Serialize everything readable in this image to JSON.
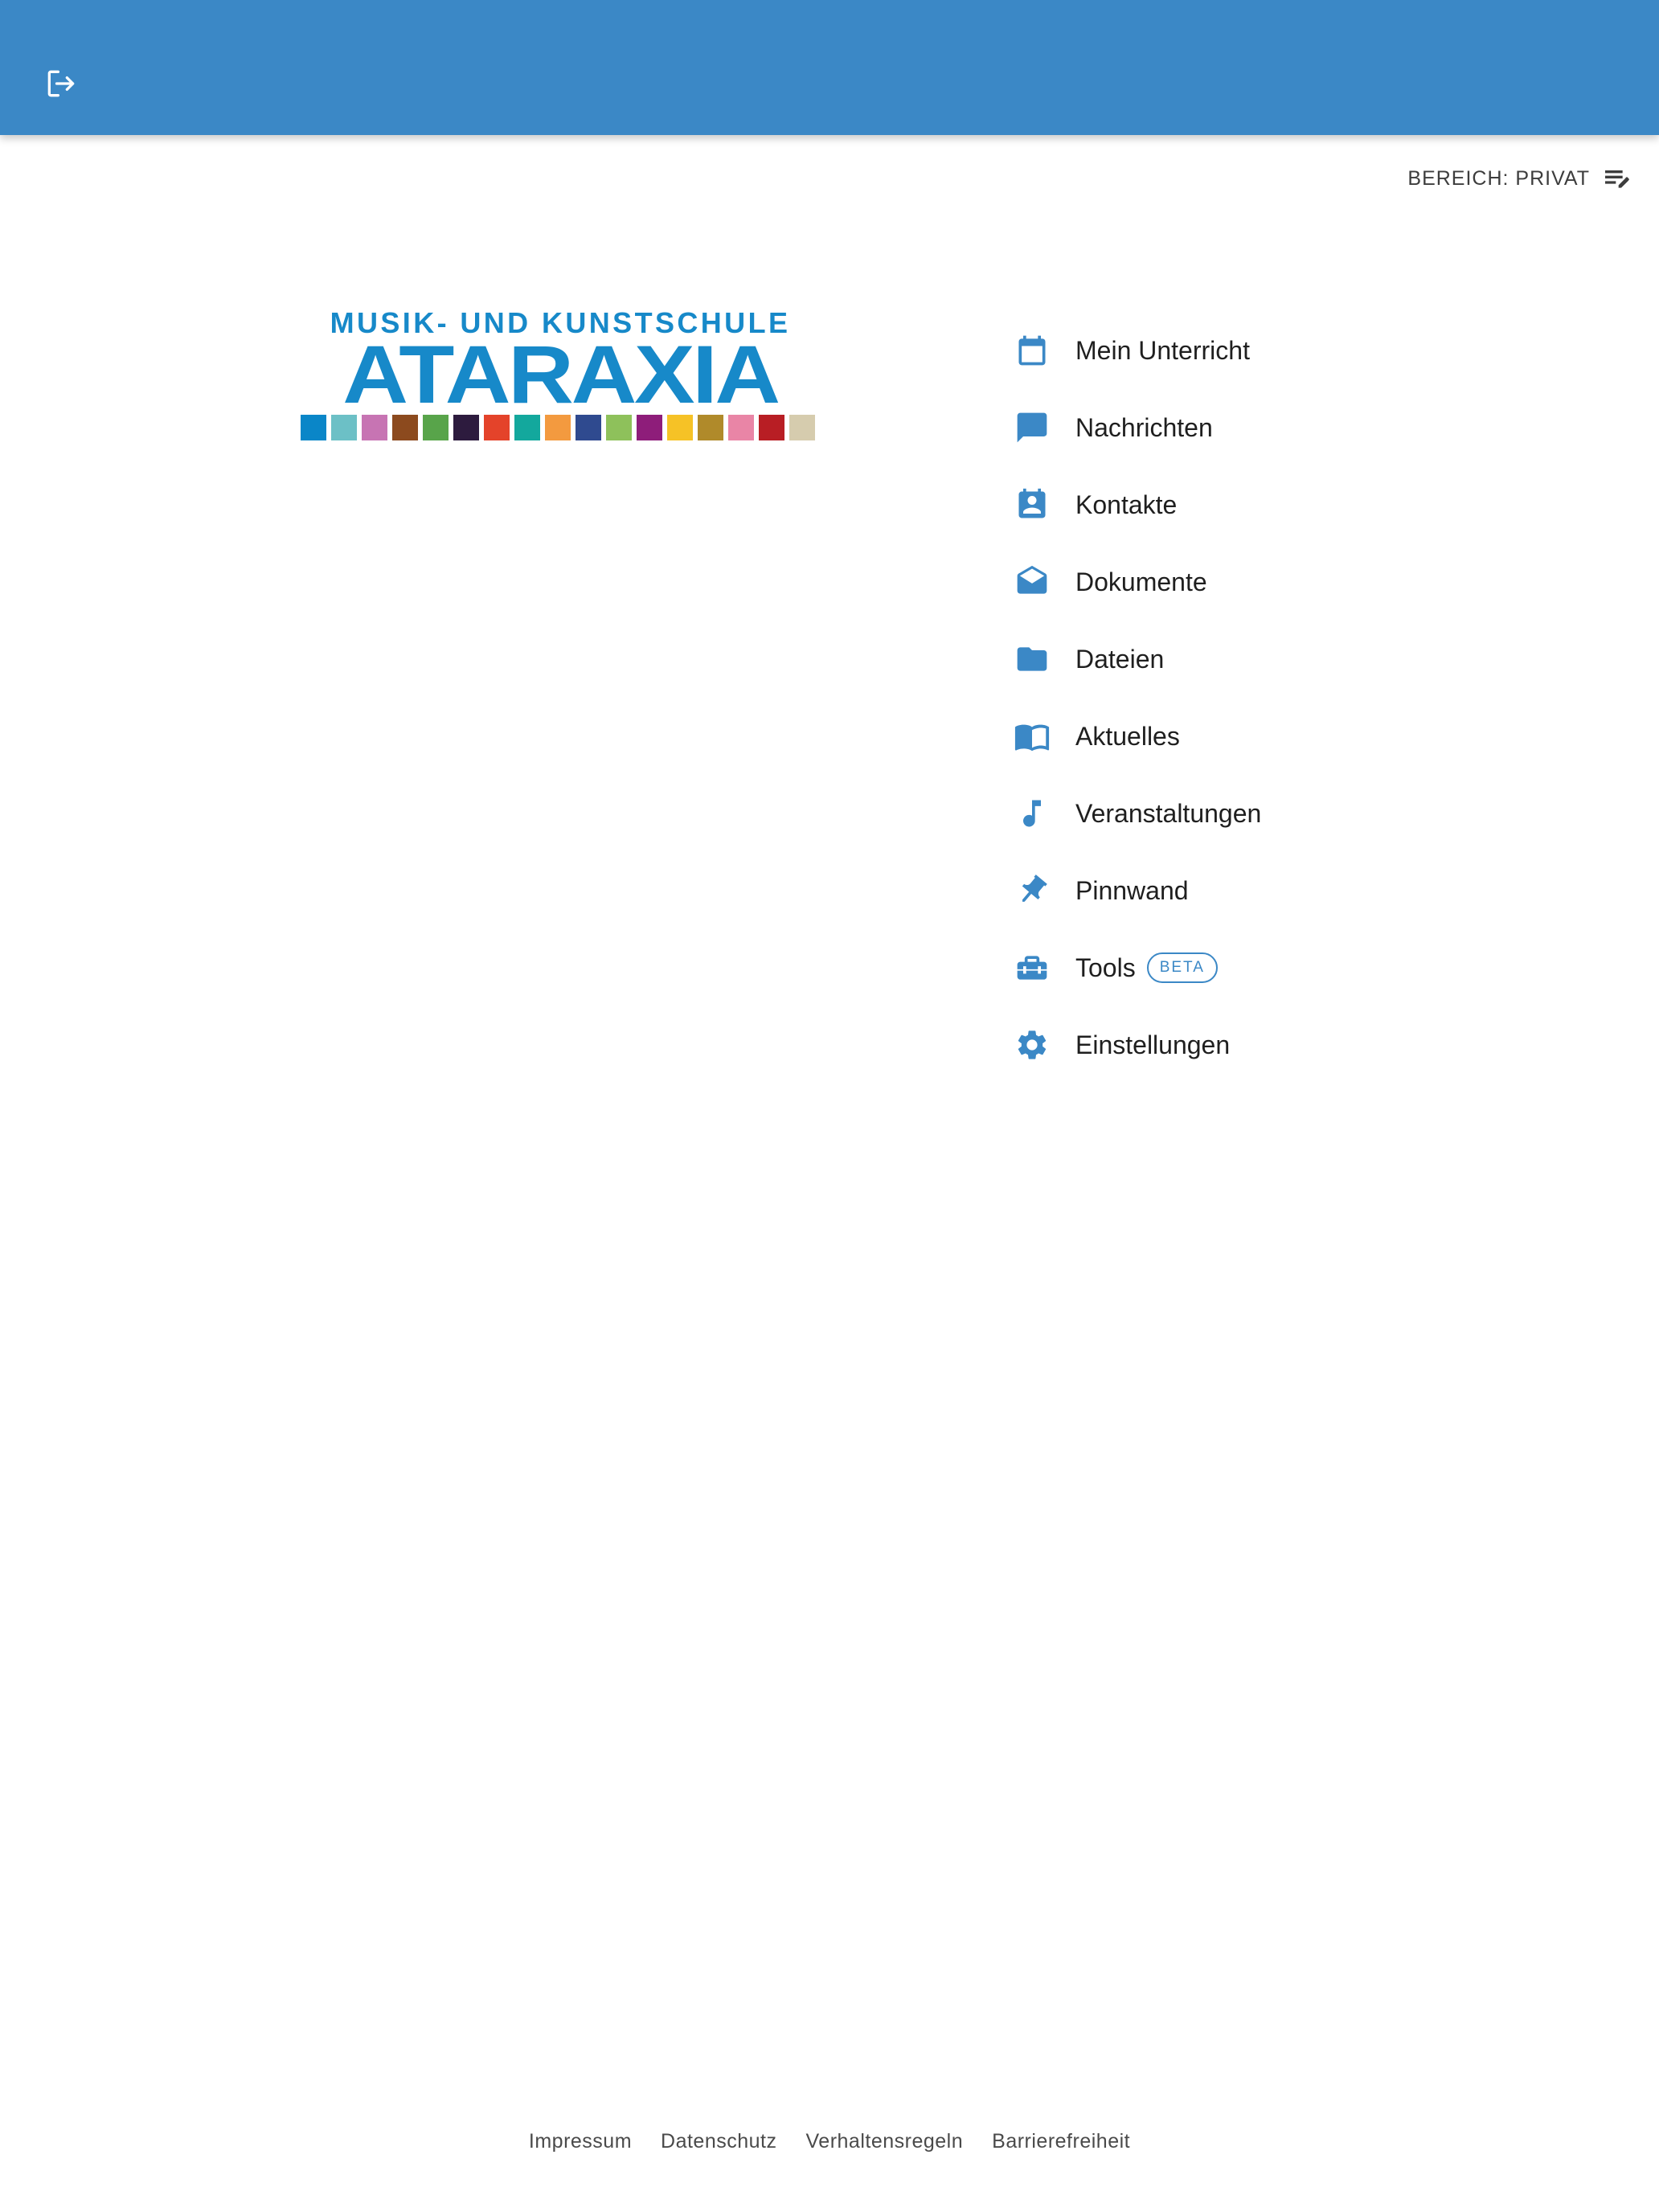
{
  "header": {
    "logout_icon": "logout-icon",
    "background_color": "#3b88c6"
  },
  "scope": {
    "label": "BEREICH: PRIVAT",
    "icon": "edit-list-icon"
  },
  "logo": {
    "line1": "MUSIK- UND KUNSTSCHULE",
    "line2": "ATARAXIA",
    "square_colors": [
      "#0a86c8",
      "#6cc0c6",
      "#c774b3",
      "#8c4a1e",
      "#58a44a",
      "#2d1b3e",
      "#e4432a",
      "#13a89d",
      "#f39a3f",
      "#2f4a8f",
      "#8ec15b",
      "#8e1d7a",
      "#f6c226",
      "#b08a2a",
      "#e985a6",
      "#b81e24",
      "#d6ccae"
    ]
  },
  "nav": {
    "items": [
      {
        "label": "Mein Unterricht",
        "icon": "calendar-icon"
      },
      {
        "label": "Nachrichten",
        "icon": "chat-icon"
      },
      {
        "label": "Kontakte",
        "icon": "contact-icon"
      },
      {
        "label": "Dokumente",
        "icon": "envelope-open-icon"
      },
      {
        "label": "Dateien",
        "icon": "folder-icon"
      },
      {
        "label": "Aktuelles",
        "icon": "book-icon"
      },
      {
        "label": "Veranstaltungen",
        "icon": "music-note-icon"
      },
      {
        "label": "Pinnwand",
        "icon": "pin-icon"
      },
      {
        "label": "Tools",
        "icon": "toolbox-icon",
        "badge": "BETA"
      },
      {
        "label": "Einstellungen",
        "icon": "gear-icon"
      }
    ]
  },
  "footer": {
    "links": [
      "Impressum",
      "Datenschutz",
      "Verhaltensregeln",
      "Barrierefreiheit"
    ]
  }
}
